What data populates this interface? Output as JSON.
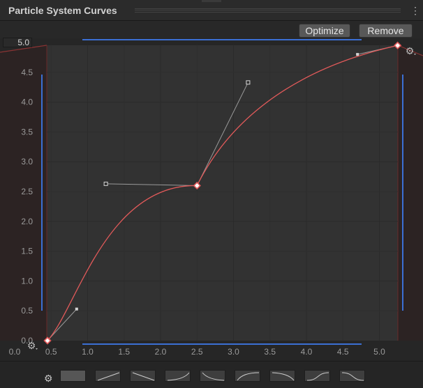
{
  "window": {
    "title": "Particle System Curves"
  },
  "toolbar": {
    "optimize_label": "Optimize",
    "remove_label": "Remove"
  },
  "axes": {
    "y_max_field": "5.0",
    "y_ticks": [
      "4.5",
      "4.0",
      "3.5",
      "3.0",
      "2.5",
      "2.0",
      "1.5",
      "1.0",
      "0.5",
      "0.0"
    ],
    "x_ticks": [
      "0.0",
      "0.5",
      "1.0",
      "1.5",
      "2.0",
      "2.5",
      "3.0",
      "3.5",
      "4.0",
      "4.5",
      "5.0"
    ]
  },
  "curve": {
    "color": "#e25a5a",
    "keys": [
      {
        "time": 0.45,
        "value": 0.0
      },
      {
        "time": 2.5,
        "value": 2.6
      },
      {
        "time": 5.25,
        "value": 4.95
      }
    ],
    "tangent_handles": [
      {
        "time": 0.85,
        "value": 0.53
      },
      {
        "time": 1.25,
        "value": 2.63
      },
      {
        "time": 3.2,
        "value": 4.33
      },
      {
        "time": 4.7,
        "value": 4.8
      }
    ]
  },
  "presets": {
    "count": 9
  },
  "icons": {
    "menu": "kebab-menu-icon",
    "settings": "gear-icon"
  }
}
